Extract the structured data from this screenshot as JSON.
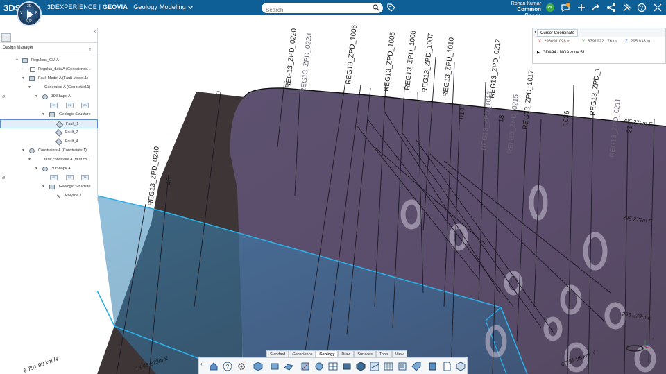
{
  "app": {
    "logo": "3DS",
    "brand_prefix": "3DEXPERIENCE",
    "brand_sep": " | ",
    "brand_product": "GEOVIA",
    "app_name": "Geology Modeling",
    "compass": {
      "top": "3D",
      "left": "V",
      "right": "R",
      "bottom": "V,R"
    }
  },
  "search": {
    "placeholder": "Search"
  },
  "user": {
    "name": "Rohan Kumar",
    "space": "Common Space",
    "initials": "RK",
    "notif_count": "5"
  },
  "panel": {
    "title": "Design Manager",
    "tree": [
      {
        "label": "Regulsus_GM A",
        "indent": 0
      },
      {
        "label": "Regulus_data A (Geoscience...",
        "indent": 1
      },
      {
        "label": "Fault Model A (Fault Model.1)",
        "indent": 1
      },
      {
        "label": "Generated A (Generated.1)",
        "indent": 2
      },
      {
        "label": "3DShape A",
        "indent": 3
      },
      {
        "label": "",
        "indent": 4
      },
      {
        "label": "Geologic Structure",
        "indent": 4
      },
      {
        "label": "Fault_1",
        "indent": 5
      },
      {
        "label": "Fault_2",
        "indent": 5
      },
      {
        "label": "Fault_4",
        "indent": 5
      },
      {
        "label": "Constraints A (Constraints.1)",
        "indent": 1
      },
      {
        "label": "fault constraint A (fault co...",
        "indent": 2
      },
      {
        "label": "3DShape A",
        "indent": 3
      },
      {
        "label": "",
        "indent": 4
      },
      {
        "label": "Geologic Structure",
        "indent": 4
      },
      {
        "label": "Polyline 1",
        "indent": 5
      }
    ],
    "mini_labels": [
      "VP",
      "PZ",
      "ZA"
    ]
  },
  "coord": {
    "title": "Cursor Coordinate",
    "x_label": "X",
    "x_value": "296091.098 m",
    "y_label": "Y",
    "y_value": "6791922.176 m",
    "z_label": "Z",
    "z_value": "295.838 m",
    "crs": "GDA94 / MGA zone 51"
  },
  "scene": {
    "drillholes": [
      "REG13_ZPD_0220",
      "REG13_ZPD_0240",
      "REG13_ZPD_0223",
      "REG13_ZPD_1006",
      "REG13_ZPD_1005",
      "REG13_ZPD_1008",
      "REG13_ZPD_1007",
      "REG13_ZPD_1010",
      "REG13_ZPD_0212",
      "REG13_ZPD_1013",
      "REG13_ZPD_0215",
      "REG13_ZPD_1017",
      "1036",
      "REG13_ZPD_0211",
      "014",
      "18",
      "214",
      "43",
      "0",
      "REG13_ZPD_1"
    ],
    "grid_labels": [
      "295 279m E",
      "295 279m E",
      "295 279m E",
      "6 791 98 km N",
      "1 995 279m E",
      "6 791 98 km N"
    ]
  },
  "actionbar": {
    "tabs": [
      "Standard",
      "Geoscience",
      "Geology",
      "Draw",
      "Surfaces",
      "Tools",
      "View"
    ],
    "active_tab": "Geology"
  },
  "colors": {
    "topbar": "#0f5f97",
    "surface": "#5a4e6c",
    "surface_dark": "#3b3436",
    "plane_blue": "#3f8fbd",
    "outline": "#2aa5dc"
  }
}
